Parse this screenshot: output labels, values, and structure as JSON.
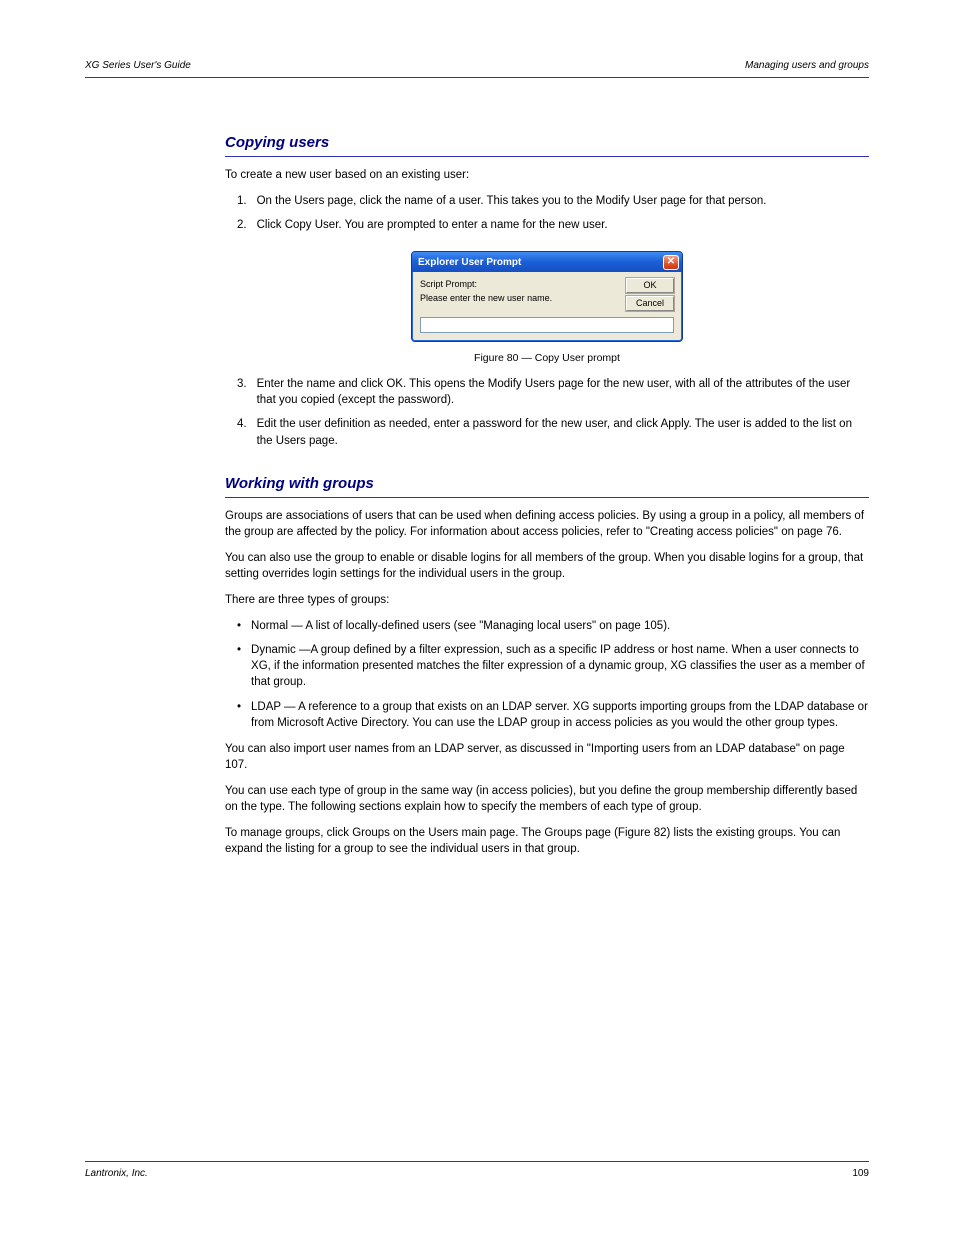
{
  "header": {
    "left": "XG Series User's Guide",
    "right": "Managing users and groups"
  },
  "sections": {
    "copy_users": {
      "title": "Copying users",
      "intro": "To create a new user based on an existing user:",
      "steps": [
        "On the Users page, click the name of a user. This takes you to the Modify User page for that person.",
        "Click Copy User. You are prompted to enter a name for the new user."
      ],
      "after_figure": "Enter the name and click OK. This opens the Modify Users page for the new user, with all of the attributes of the user that you copied (except the password).",
      "last_step": "Edit the user definition as needed, enter a password for the new user, and click Apply. The user is added to the list on the Users page."
    },
    "groups": {
      "title": "Working with groups",
      "p1": "Groups are associations of users that can be used when defining access policies. By using a group in a policy, all members of the group are affected by the policy. For information about access policies, refer to \"Creating access policies\" on page 76.",
      "p2": "You can also use the group to enable or disable logins for all members of the group. When you disable logins for a group, that setting overrides login settings for the individual users in the group.",
      "p3": "There are three types of groups:",
      "bullets": [
        "Normal — A list of locally-defined users (see \"Managing local users\" on page 105).",
        "Dynamic —A group defined by a filter expression, such as a specific IP address or host name. When a user connects to XG, if the information presented matches the filter expression of a dynamic group, XG classifies the user as a member of that group.",
        "LDAP — A reference to a group that exists on an LDAP server. XG supports importing groups from the LDAP database or from Microsoft Active Directory. You can use the LDAP group in access policies as you would the other group types."
      ],
      "p4": "You can also import user names from an LDAP server, as discussed in \"Importing users from an LDAP database\" on page 107.",
      "p5": "You can use each type of group in the same way (in access policies), but you define the group membership differently based on the type. The following sections explain how to specify the members of each type of group.",
      "p6": "To manage groups, click Groups on the Users main page. The Groups page (Figure 82) lists the existing groups. You can expand the listing for a group to see the individual users in that group."
    }
  },
  "dialog": {
    "title": "Explorer User Prompt",
    "script_prompt_label": "Script Prompt:",
    "message": "Please enter the new user name.",
    "ok": "OK",
    "cancel": "Cancel",
    "input_value": ""
  },
  "figure": {
    "caption": "Figure 80 — Copy User prompt"
  },
  "footer": {
    "left": "Lantronix, Inc.",
    "right": "109"
  },
  "step_numbers": [
    "1.",
    "2.",
    "3.",
    "4."
  ]
}
